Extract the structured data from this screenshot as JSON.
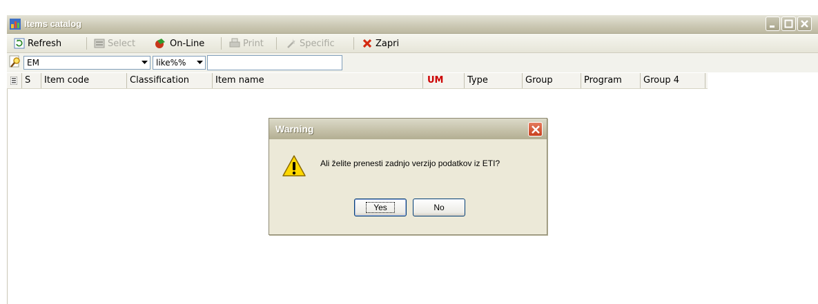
{
  "window": {
    "title": "Items catalog"
  },
  "toolbar": {
    "refresh": "Refresh",
    "select": "Select",
    "online": "On-Line",
    "print": "Print",
    "specific": "Specific",
    "zapri": "Zapri"
  },
  "search": {
    "field_value": "EM",
    "operator_value": "like%%",
    "text_value": ""
  },
  "grid": {
    "columns": [
      "S",
      "Item code",
      "Classification",
      "Item name",
      "UM",
      "Type",
      "Group",
      "Program",
      "Group 4"
    ]
  },
  "dialog": {
    "title": "Warning",
    "message": "Ali želite prenesti zadnjo verzijo podatkov iz ETI?",
    "yes_label": "Yes",
    "no_label": "No"
  },
  "colors": {
    "um_header": "#cc0000",
    "dialog_bg": "#ece9d8"
  }
}
